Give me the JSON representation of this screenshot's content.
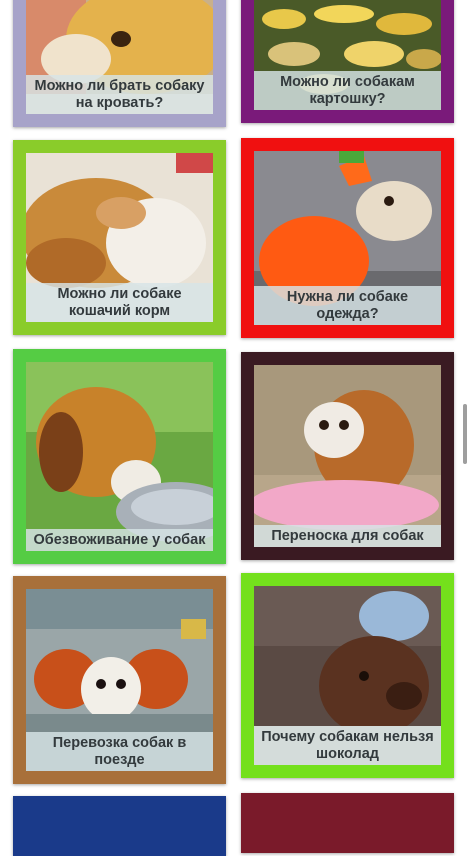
{
  "colors": {
    "card1": "#a7a3c9",
    "card2": "#7a1a7a",
    "card3": "#8acc2a",
    "card4": "#f01010",
    "card5": "#55cc44",
    "card6": "#3a1a22",
    "card7": "#a8703a",
    "card8": "#74e01c",
    "card9": "#1a3a8a",
    "card10": "#7a1a2a"
  },
  "cards": [
    {
      "title": "Можно ли брать собаку на кровать?"
    },
    {
      "title": "Можно ли собакам картошку?"
    },
    {
      "title": "Можно ли собаке кошачий корм"
    },
    {
      "title": "Нужна ли собаке одежда?"
    },
    {
      "title": "Обезвоживание у собак"
    },
    {
      "title": "Переноска для собак"
    },
    {
      "title": "Перевозка собак в поезде"
    },
    {
      "title": "Почему собакам нельзя шоколад"
    }
  ]
}
